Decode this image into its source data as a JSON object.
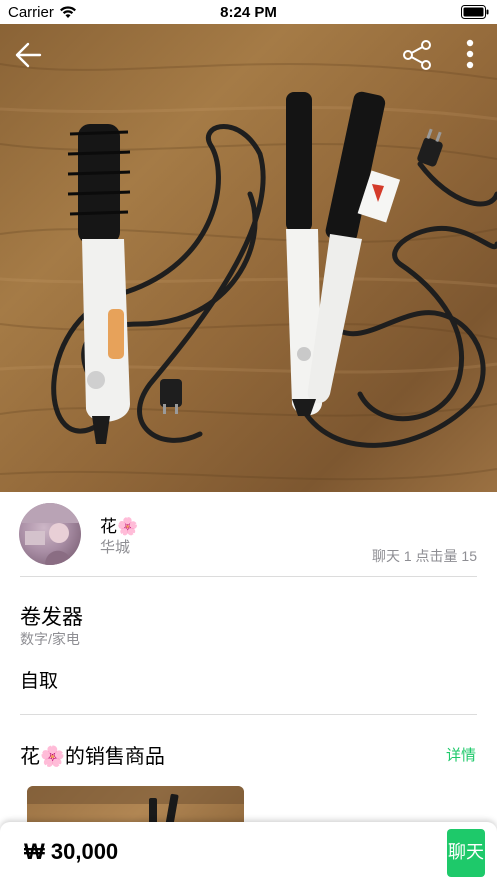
{
  "status_bar": {
    "carrier": "Carrier",
    "time": "8:24 PM"
  },
  "navigation": {
    "back_icon": "back-arrow-icon",
    "share_icon": "share-icon",
    "more_icon": "more-vertical-icon"
  },
  "seller": {
    "name": "花🌸",
    "location": "华城",
    "stats": "聊天 1  点击量 15"
  },
  "item": {
    "title": "卷发器",
    "category": "数字/家电",
    "description": "自取"
  },
  "seller_items": {
    "title": "花🌸的销售商品",
    "detail_label": "详情"
  },
  "bottom_bar": {
    "price": "₩ 30,000",
    "chat_label": "聊天"
  },
  "colors": {
    "accent": "#1ec96a",
    "secondary_text": "#8e8e93"
  }
}
